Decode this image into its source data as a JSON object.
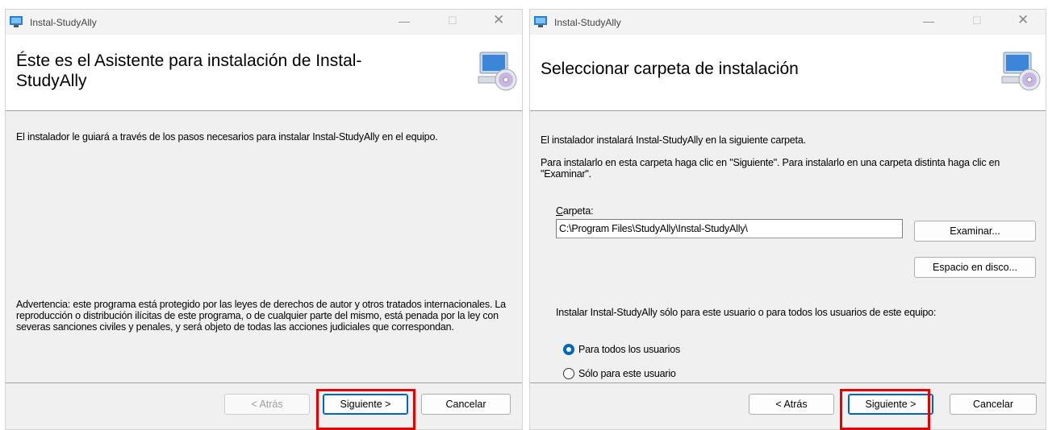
{
  "left": {
    "window_title": "Instal-StudyAlly",
    "header_title": "Éste es el Asistente para instalación de Instal-StudyAlly",
    "intro": "El instalador le guiará a través de los pasos necesarios para instalar Instal-StudyAlly en el equipo.",
    "warning": "Advertencia: este programa está protegido por las leyes de derechos de autor y otros tratados internacionales. La reproducción o distribución ilícitas de este programa, o de cualquier parte del mismo, está penada por la ley con severas sanciones civiles y penales, y será objeto de todas las acciones judiciales que correspondan.",
    "back_label": "< Atrás",
    "next_label": "Siguiente >",
    "cancel_label": "Cancelar"
  },
  "right": {
    "window_title": "Instal-StudyAlly",
    "header_title": "Seleccionar carpeta de instalación",
    "intro": "El instalador instalará Instal-StudyAlly en la siguiente carpeta.",
    "instructions": "Para instalarlo en esta carpeta haga clic en \"Siguiente\". Para instalarlo en una carpeta distinta haga clic en \"Examinar\".",
    "folder_label_accel": "C",
    "folder_label_rest": "arpeta:",
    "folder_value": "C:\\Program Files\\StudyAlly\\Instal-StudyAlly\\",
    "browse_label": "Examinar...",
    "disk_label": "Espacio en disco...",
    "scope_question": "Instalar Instal-StudyAlly sólo para este usuario o para todos los usuarios de este equipo:",
    "option_all": "Para todos los usuarios",
    "option_me": "Sólo para este usuario",
    "back_label": "< Atrás",
    "next_label": "Siguiente >",
    "cancel_label": "Cancelar"
  },
  "icons": {
    "app": "installer-app-icon",
    "header": "computer-cd-icon",
    "minimize": "minimize-icon",
    "maximize": "maximize-icon",
    "close": "close-icon"
  },
  "colors": {
    "highlight": "#e60000",
    "accent": "#0067c0"
  }
}
